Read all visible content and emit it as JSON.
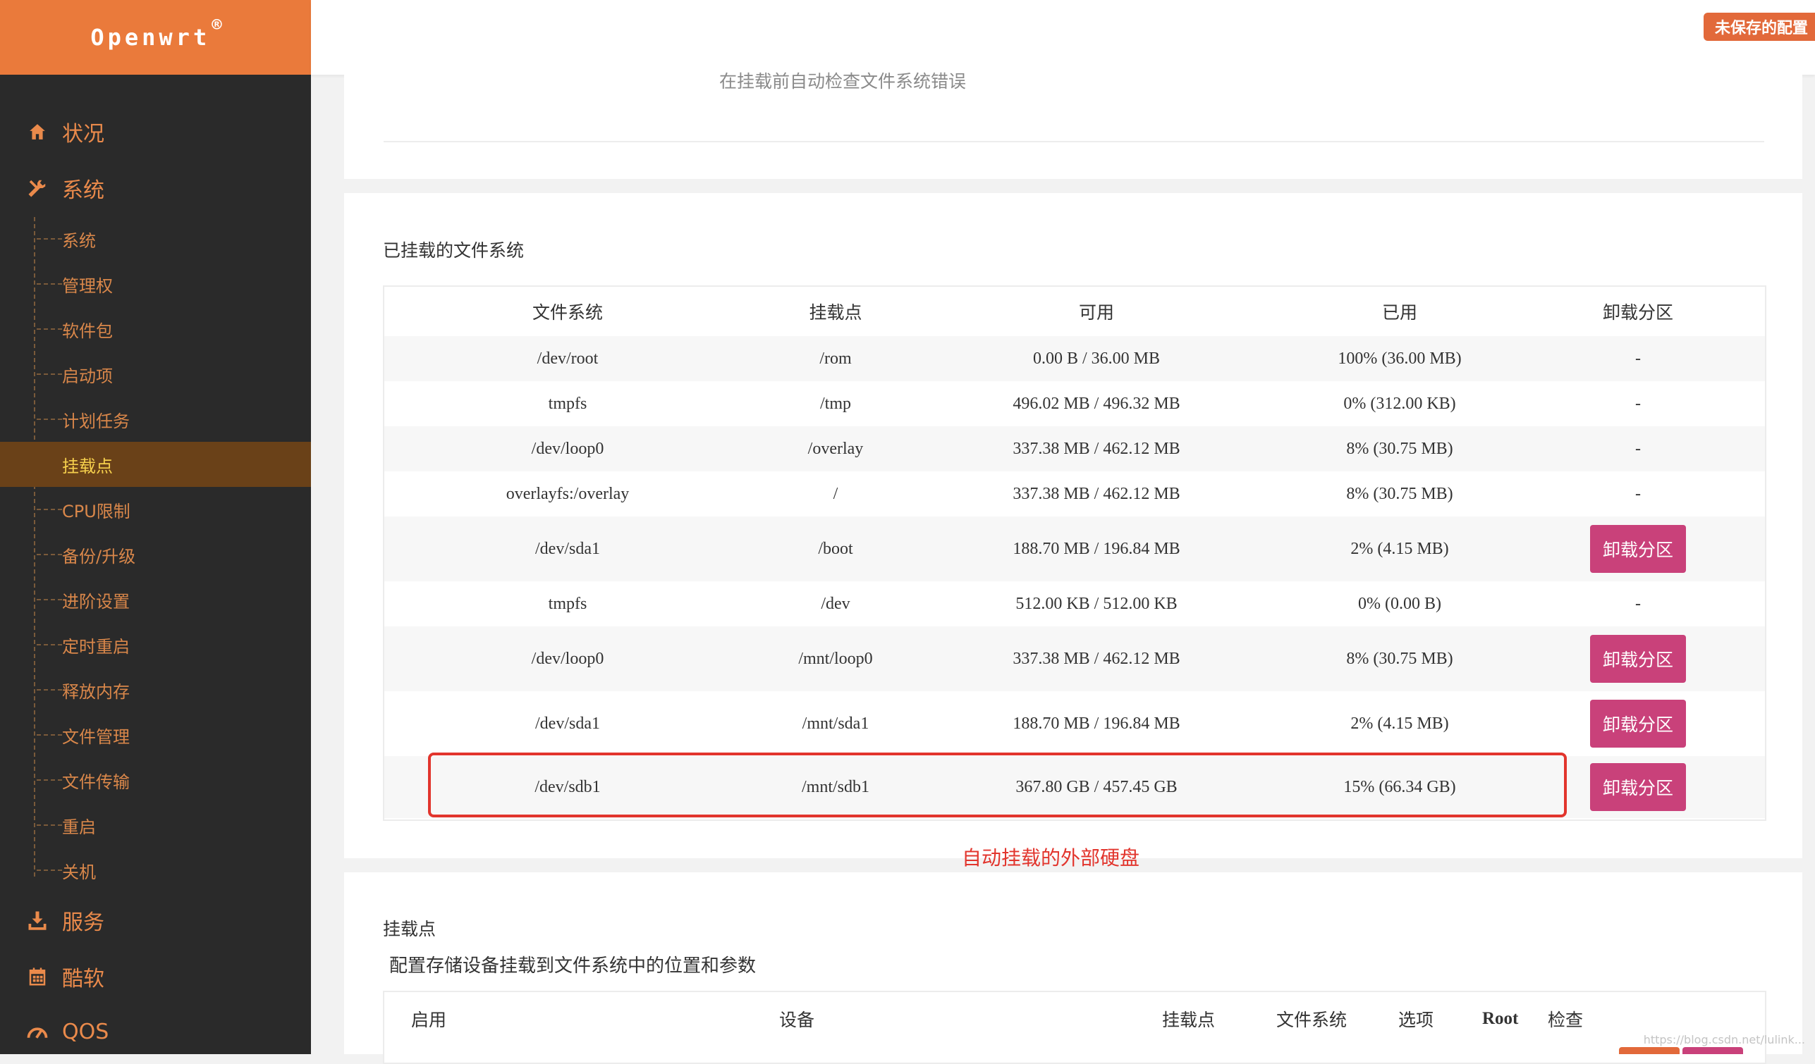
{
  "brand": {
    "name": "Openwrt",
    "mark": "®"
  },
  "header": {
    "unsaved_label": "未保存的配置"
  },
  "sidebar": {
    "top_items": [
      {
        "label": "状况",
        "icon": "home-icon"
      },
      {
        "label": "系统",
        "icon": "tools-icon"
      }
    ],
    "sub_items": [
      {
        "label": "系统"
      },
      {
        "label": "管理权"
      },
      {
        "label": "软件包"
      },
      {
        "label": "启动项"
      },
      {
        "label": "计划任务"
      },
      {
        "label": "挂载点",
        "active": true
      },
      {
        "label": "CPU限制"
      },
      {
        "label": "备份/升级"
      },
      {
        "label": "进阶设置"
      },
      {
        "label": "定时重启"
      },
      {
        "label": "释放内存"
      },
      {
        "label": "文件管理"
      },
      {
        "label": "文件传输"
      },
      {
        "label": "重启"
      },
      {
        "label": "关机"
      }
    ],
    "bottom_items": [
      {
        "label": "服务",
        "icon": "download-icon"
      },
      {
        "label": "酷软",
        "icon": "calendar-icon"
      },
      {
        "label": "QOS",
        "icon": "gauge-icon"
      }
    ]
  },
  "top_section": {
    "note": "在挂载前自动检查文件系统错误"
  },
  "mounted": {
    "title": "已挂载的文件系统",
    "columns": [
      "文件系统",
      "挂载点",
      "可用",
      "已用",
      "卸载分区"
    ],
    "unmount_label": "卸载分区",
    "rows": [
      {
        "fs": "/dev/root",
        "mount": "/rom",
        "avail": "0.00 B / 36.00 MB",
        "used": "100% (36.00 MB)",
        "action": "-"
      },
      {
        "fs": "tmpfs",
        "mount": "/tmp",
        "avail": "496.02 MB / 496.32 MB",
        "used": "0% (312.00 KB)",
        "action": "-"
      },
      {
        "fs": "/dev/loop0",
        "mount": "/overlay",
        "avail": "337.38 MB / 462.12 MB",
        "used": "8% (30.75 MB)",
        "action": "-"
      },
      {
        "fs": "overlayfs:/overlay",
        "mount": "/",
        "avail": "337.38 MB / 462.12 MB",
        "used": "8% (30.75 MB)",
        "action": "-"
      },
      {
        "fs": "/dev/sda1",
        "mount": "/boot",
        "avail": "188.70 MB / 196.84 MB",
        "used": "2% (4.15 MB)",
        "action": "button"
      },
      {
        "fs": "tmpfs",
        "mount": "/dev",
        "avail": "512.00 KB / 512.00 KB",
        "used": "0% (0.00 B)",
        "action": "-"
      },
      {
        "fs": "/dev/loop0",
        "mount": "/mnt/loop0",
        "avail": "337.38 MB / 462.12 MB",
        "used": "8% (30.75 MB)",
        "action": "button"
      },
      {
        "fs": "/dev/sda1",
        "mount": "/mnt/sda1",
        "avail": "188.70 MB / 196.84 MB",
        "used": "2% (4.15 MB)",
        "action": "button"
      },
      {
        "fs": "/dev/sdb1",
        "mount": "/mnt/sdb1",
        "avail": "367.80 GB / 457.45 GB",
        "used": "15% (66.34 GB)",
        "action": "button"
      }
    ],
    "annotation": "自动挂载的外部硬盘"
  },
  "mount_points": {
    "title": "挂载点",
    "description": "配置存储设备挂载到文件系统中的位置和参数",
    "columns": [
      "启用",
      "设备",
      "挂载点",
      "文件系统",
      "选项",
      "Root",
      "检查"
    ]
  },
  "watermark": "https://blog.csdn.net/lulink..."
}
